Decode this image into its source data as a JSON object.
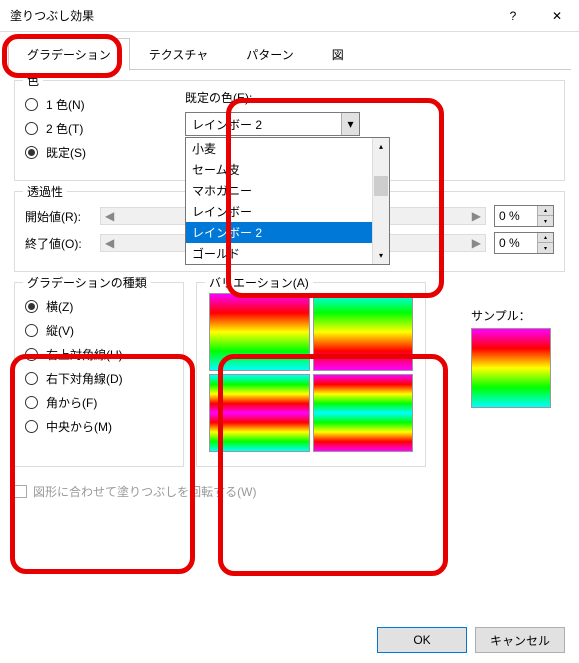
{
  "title": "塗りつぶし効果",
  "titlebar": {
    "help": "?",
    "close": "✕"
  },
  "tabs": [
    "グラデーション",
    "テクスチャ",
    "パターン",
    "図"
  ],
  "color_group": {
    "title": "色",
    "one": "1 色(N)",
    "two": "2 色(T)",
    "preset": "既定(S)"
  },
  "preset": {
    "label": "既定の色(E):",
    "value": "レインボー 2",
    "options": [
      "小麦",
      "セーム皮",
      "マホガニー",
      "レインボー",
      "レインボー 2",
      "ゴールド"
    ]
  },
  "trans": {
    "title": "透過性",
    "start_label": "開始値(R):",
    "end_label": "終了値(O):",
    "start_val": "0 %",
    "end_val": "0 %"
  },
  "gtype": {
    "title": "グラデーションの種類",
    "opts": [
      "横(Z)",
      "縦(V)",
      "右上対角線(U)",
      "右下対角線(D)",
      "角から(F)",
      "中央から(M)"
    ]
  },
  "variations_label": "バリエーション(A)",
  "sample_label": "サンプル：",
  "rotate_label": "図形に合わせて塗りつぶしを回転する(W)",
  "buttons": {
    "ok": "OK",
    "cancel": "キャンセル"
  }
}
